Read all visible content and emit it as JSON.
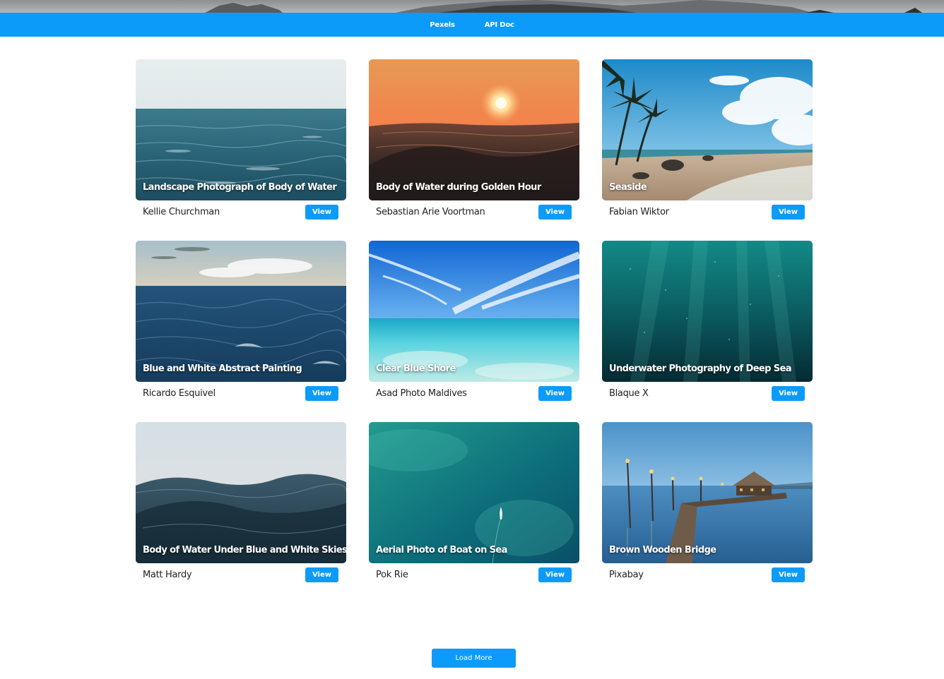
{
  "nav": {
    "links": [
      {
        "label": "Pexels"
      },
      {
        "label": "API Doc"
      }
    ]
  },
  "cards": [
    {
      "title": "Landscape Photograph of Body of Water",
      "photographer": "Kellie Churchman",
      "button": "View",
      "scene": "open-sea"
    },
    {
      "title": "Body of Water during Golden Hour",
      "photographer": "Sebastian Arie Voortman",
      "button": "View",
      "scene": "golden-hour"
    },
    {
      "title": "Seaside",
      "photographer": "Fabian Wiktor",
      "button": "View",
      "scene": "beach-palms"
    },
    {
      "title": "Blue and White Abstract Painting",
      "photographer": "Ricardo Esquivel",
      "button": "View",
      "scene": "deep-waves"
    },
    {
      "title": "Clear Blue Shore",
      "photographer": "Asad Photo Maldives",
      "button": "View",
      "scene": "clear-shore"
    },
    {
      "title": "Underwater Photography of Deep Sea",
      "photographer": "Blaque X",
      "button": "View",
      "scene": "underwater"
    },
    {
      "title": "Body of Water Under Blue and White Skies",
      "photographer": "Matt Hardy",
      "button": "View",
      "scene": "wave-closeup"
    },
    {
      "title": "Aerial Photo of Boat on Sea",
      "photographer": "Pok Rie",
      "button": "View",
      "scene": "aerial-boat"
    },
    {
      "title": "Brown Wooden Bridge",
      "photographer": "Pixabay",
      "button": "View",
      "scene": "pier-dusk"
    }
  ],
  "load_more_label": "Load More",
  "colors": {
    "accent": "#0d9bf9",
    "text": "#222222",
    "background": "#ffffff"
  }
}
